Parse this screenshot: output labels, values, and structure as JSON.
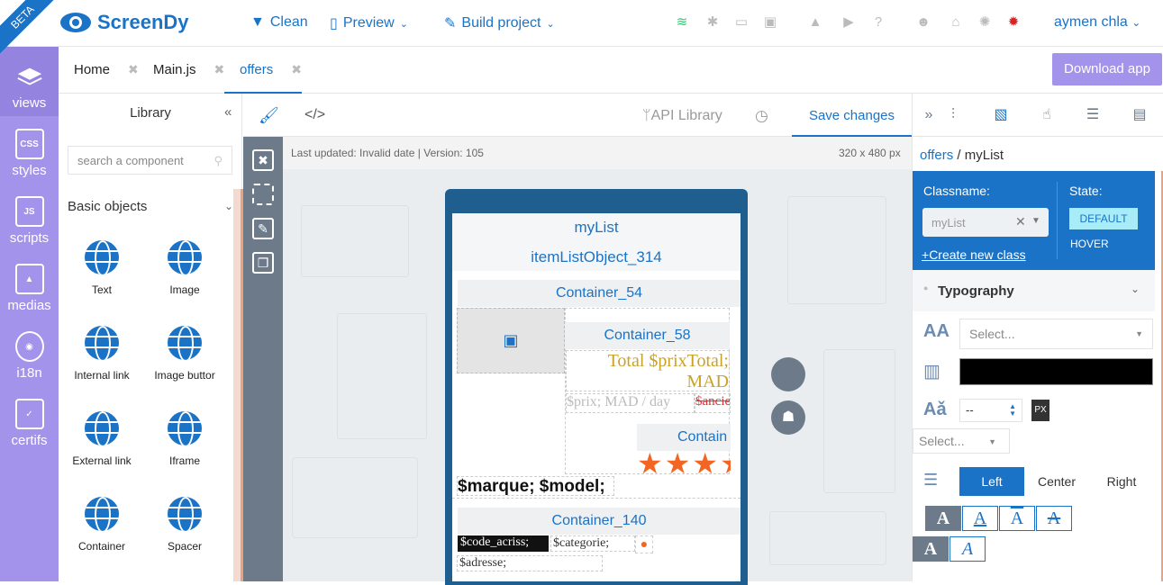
{
  "app": {
    "name": "ScreenDy",
    "beta": "BETA"
  },
  "topnav": {
    "clean": "Clean",
    "preview": "Preview",
    "build": "Build project",
    "user": "aymen chla"
  },
  "sidebar": {
    "items": [
      {
        "label": "views"
      },
      {
        "label": "styles",
        "icon_text": "CSS"
      },
      {
        "label": "scripts",
        "icon_text": "JS"
      },
      {
        "label": "medias"
      },
      {
        "label": "i18n"
      },
      {
        "label": "certifs"
      }
    ]
  },
  "tabs": [
    {
      "label": "Home"
    },
    {
      "label": "Main.js"
    },
    {
      "label": "offers"
    }
  ],
  "download": "Download app",
  "library": {
    "title": "Library",
    "search_placeholder": "search a component",
    "section": "Basic objects",
    "components": [
      "Text",
      "Image",
      "Internal link",
      "Image buttor",
      "External link",
      "Iframe",
      "Container",
      "Spacer"
    ]
  },
  "editor": {
    "api_library": "API Library",
    "save": "Save changes",
    "updated": "Last updated: Invalid date | Version: 105",
    "dims": "320 x 480 px"
  },
  "screen": {
    "mylist": "myList",
    "item": "itemListObject_314",
    "c54": "Container_54",
    "c58": "Container_58",
    "total": "Total $prixTotal; MAD",
    "prix": "$prix; MAD / day",
    "anc": "$ancien",
    "contain": "Contain",
    "marque": "$marque; $model;",
    "c140": "Container_140",
    "code": "$code_acriss;",
    "categorie": "$categorie;",
    "adresse": "$adresse;"
  },
  "panel": {
    "crumb_page": "offers",
    "crumb_sep": "/",
    "crumb_item": "myList",
    "classname_label": "Classname:",
    "class_value": "myList",
    "state_label": "State:",
    "state_default": "DEFAULT",
    "state_hover": "HOVER",
    "new_class": "Create new class",
    "typography": "Typography",
    "font_select": "Select...",
    "color": "#000000",
    "size_value": "--",
    "size_unit": "PX",
    "weight_select": "Select...",
    "align": [
      "Left",
      "Center",
      "Right"
    ]
  },
  "colors": {
    "accent": "#1a73c7",
    "sidebar": "#a393eb",
    "star": "#f26522"
  }
}
